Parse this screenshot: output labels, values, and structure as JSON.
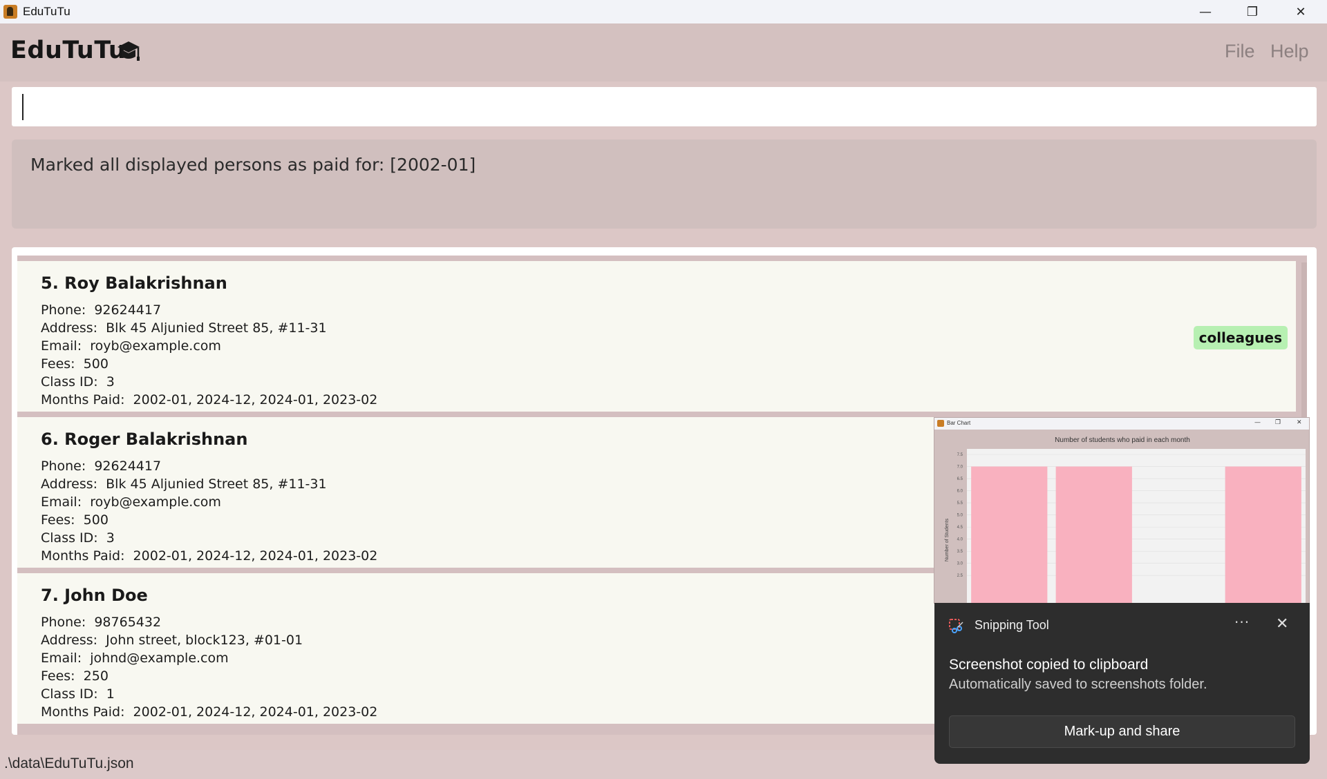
{
  "window": {
    "title": "EduTuTu",
    "controls": {
      "minimize": "—",
      "restore": "❐",
      "close": "✕"
    }
  },
  "header": {
    "brand": "EduTuTu",
    "menu": [
      "File",
      "Help"
    ]
  },
  "command": {
    "value": ""
  },
  "result": {
    "message": "Marked all displayed persons as paid for: [2002-01]"
  },
  "persons": [
    {
      "name": "5. Roy Balakrishnan",
      "phone": "Phone:  92624417",
      "address": "Address:  Blk 45 Aljunied Street 85, #11-31",
      "email": "Email:  royb@example.com",
      "fees": "Fees:  500",
      "class_id": "Class ID:  3",
      "months_paid": "Months Paid:  2002-01, 2024-12, 2024-01, 2023-02",
      "tag": "colleagues"
    },
    {
      "name": "6. Roger Balakrishnan",
      "phone": "Phone:  92624417",
      "address": "Address:  Blk 45 Aljunied Street 85, #11-31",
      "email": "Email:  royb@example.com",
      "fees": "Fees:  500",
      "class_id": "Class ID:  3",
      "months_paid": "Months Paid:  2002-01, 2024-12, 2024-01, 2023-02"
    },
    {
      "name": "7. John Doe",
      "phone": "Phone:  98765432",
      "address": "Address:  John street, block123, #01-01",
      "email": "Email:  johnd@example.com",
      "fees": "Fees:  250",
      "class_id": "Class ID:  1",
      "months_paid": "Months Paid:  2002-01, 2024-12, 2024-01, 2023-02"
    }
  ],
  "statusbar": {
    "path": ".\\data\\EduTuTu.json"
  },
  "chart_window": {
    "title": "Bar Chart"
  },
  "chart_data": {
    "type": "bar",
    "title": "Number of students who paid in each month",
    "ylabel": "Number of Students",
    "xlabel": "",
    "ylim": [
      2.5,
      7.5
    ],
    "yticks": [
      "7.5",
      "7.0",
      "6.5",
      "6.0",
      "5.5",
      "5.0",
      "4.5",
      "4.0",
      "3.5",
      "3.0",
      "2.5"
    ],
    "values": [
      7.0,
      7.0,
      null,
      7.0
    ],
    "bar_color": "#f9b1bf"
  },
  "toast": {
    "app_name": "Snipping Tool",
    "more": "···",
    "close": "✕",
    "title": "Screenshot copied to clipboard",
    "subtitle": "Automatically saved to screenshots folder.",
    "button": "Mark-up and share"
  },
  "colors": {
    "background": "#dcc7c6",
    "card": "#f8f8f1",
    "tag": "#b7f0b2",
    "toast": "#2d2d2d"
  }
}
